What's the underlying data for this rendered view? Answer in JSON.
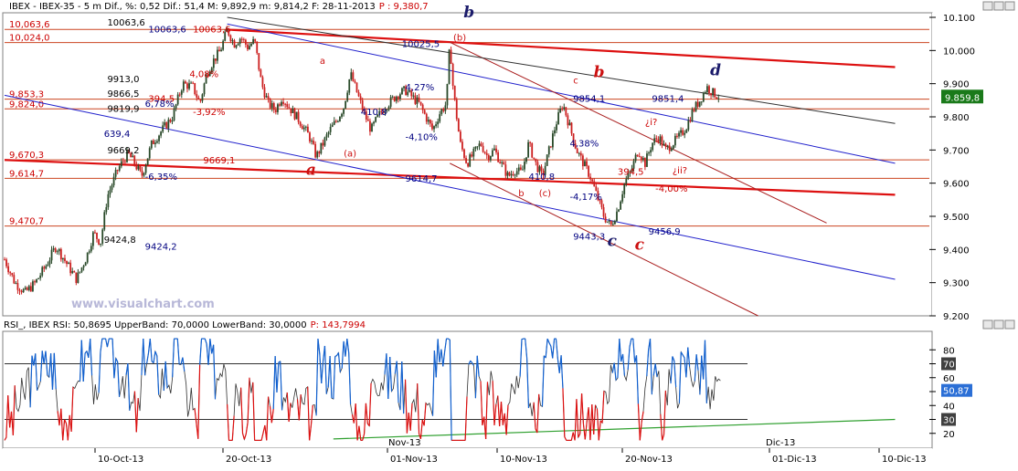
{
  "header": {
    "left": "IBEX - IBEX-35 -  5 m Dif.,  %: 0,52 Dif.: 51,4 M: 9,892,9 m: 9,814,2 F: 28-11-2013",
    "p_label": "P : ",
    "p_value": "9,380,7"
  },
  "rsi_header": {
    "left": "RSI_, IBEX RSI: 50,8695 UpperBand: 70,0000 LowerBand: 30,0000",
    "p_label": "P: ",
    "p_value": "143,7994"
  },
  "colors": {
    "candle_up": "#2a4a2a",
    "candle_down": "#cc2020",
    "level_line": "#cc4420",
    "channel_blue": "#2020cc",
    "channel_red": "#dd1010",
    "channel_darkred": "#aa2020",
    "price_box": "#1a7a1a",
    "rsi_line": "#303030",
    "rsi_up": "#1060d0",
    "rsi_down": "#dd1010",
    "rsi_trend": "#30a030",
    "rsi_box": "#2b6fd6"
  },
  "watermark": "www.visualchart.com",
  "chart_data": [
    {
      "type": "candlestick",
      "title": "IBEX - IBEX-35 - 5 m",
      "x_ticks": [
        "10-Oct-13",
        "20-Oct-13",
        "01-Nov-13",
        "10-Nov-13",
        "20-Nov-13",
        "01-Dic-13",
        "10-Dic-13"
      ],
      "month_marks": [
        "Nov-13",
        "Dic-13"
      ],
      "y_ticks": [
        "10.100",
        "10.000",
        "9.900",
        "9.800",
        "9.700",
        "9.600",
        "9.500",
        "9.400",
        "9.300",
        "9.200"
      ],
      "y_tick_values": [
        10100,
        10000,
        9900,
        9800,
        9700,
        9600,
        9500,
        9400,
        9300,
        9200
      ],
      "ylim": [
        9200,
        10100
      ],
      "last_price_label": "9.859,8",
      "last_price": 9859.8,
      "levels": [
        {
          "label": "10,063,6",
          "value": 10063.6
        },
        {
          "label": "10,024,0",
          "value": 10024.0
        },
        {
          "label": "9,853,3",
          "value": 9853.3
        },
        {
          "label": "9,824,0",
          "value": 9824.0
        },
        {
          "label": "9,670,3",
          "value": 9670.3
        },
        {
          "label": "9,614,7",
          "value": 9614.7
        },
        {
          "label": "9,470,7",
          "value": 9470.7
        }
      ],
      "path": [
        [
          0,
          9370
        ],
        [
          3,
          9300
        ],
        [
          6,
          9270
        ],
        [
          9,
          9300
        ],
        [
          12,
          9350
        ],
        [
          15,
          9410
        ],
        [
          18,
          9360
        ],
        [
          21,
          9310
        ],
        [
          24,
          9380
        ],
        [
          26,
          9450
        ],
        [
          28,
          9420
        ],
        [
          30,
          9560
        ],
        [
          33,
          9640
        ],
        [
          36,
          9690
        ],
        [
          38,
          9660
        ],
        [
          40,
          9620
        ],
        [
          43,
          9720
        ],
        [
          46,
          9760
        ],
        [
          49,
          9800
        ],
        [
          52,
          9900
        ],
        [
          55,
          9890
        ],
        [
          57,
          9840
        ],
        [
          59,
          9930
        ],
        [
          61,
          9970
        ],
        [
          63,
          10000
        ],
        [
          65,
          10063
        ],
        [
          67,
          10020
        ],
        [
          69,
          10040
        ],
        [
          71,
          10010
        ],
        [
          73,
          10030
        ],
        [
          75,
          9900
        ],
        [
          77,
          9840
        ],
        [
          79,
          9820
        ],
        [
          81,
          9860
        ],
        [
          83,
          9830
        ],
        [
          86,
          9790
        ],
        [
          89,
          9740
        ],
        [
          91,
          9680
        ],
        [
          93,
          9720
        ],
        [
          95,
          9760
        ],
        [
          97,
          9790
        ],
        [
          99,
          9830
        ],
        [
          101,
          9930
        ],
        [
          103,
          9870
        ],
        [
          105,
          9810
        ],
        [
          107,
          9760
        ],
        [
          109,
          9800
        ],
        [
          111,
          9830
        ],
        [
          113,
          9850
        ],
        [
          115,
          9870
        ],
        [
          117,
          9880
        ],
        [
          119,
          9860
        ],
        [
          121,
          9840
        ],
        [
          123,
          9800
        ],
        [
          125,
          9760
        ],
        [
          127,
          9810
        ],
        [
          129,
          9840
        ],
        [
          130,
          10025
        ],
        [
          131,
          9880
        ],
        [
          133,
          9720
        ],
        [
          135,
          9660
        ],
        [
          137,
          9690
        ],
        [
          139,
          9720
        ],
        [
          141,
          9680
        ],
        [
          143,
          9700
        ],
        [
          145,
          9660
        ],
        [
          147,
          9620
        ],
        [
          149,
          9640
        ],
        [
          151,
          9630
        ],
        [
          153,
          9720
        ],
        [
          155,
          9660
        ],
        [
          157,
          9620
        ],
        [
          159,
          9700
        ],
        [
          161,
          9780
        ],
        [
          163,
          9840
        ],
        [
          165,
          9770
        ],
        [
          167,
          9700
        ],
        [
          169,
          9660
        ],
        [
          171,
          9620
        ],
        [
          173,
          9560
        ],
        [
          175,
          9500
        ],
        [
          177,
          9470
        ],
        [
          179,
          9520
        ],
        [
          181,
          9600
        ],
        [
          183,
          9640
        ],
        [
          185,
          9700
        ],
        [
          187,
          9660
        ],
        [
          189,
          9720
        ],
        [
          191,
          9740
        ],
        [
          193,
          9700
        ],
        [
          195,
          9720
        ],
        [
          197,
          9740
        ],
        [
          199,
          9770
        ],
        [
          201,
          9820
        ],
        [
          203,
          9850
        ],
        [
          205,
          9890
        ],
        [
          207,
          9870
        ],
        [
          209,
          9860
        ]
      ],
      "trendlines": [
        {
          "kind": "red",
          "from": [
            0,
            9670
          ],
          "to": [
            260,
            9565
          ]
        },
        {
          "kind": "red",
          "from": [
            65,
            10063
          ],
          "to": [
            260,
            9950
          ]
        },
        {
          "kind": "blue",
          "from": [
            0,
            9865
          ],
          "to": [
            260,
            9310
          ]
        },
        {
          "kind": "blue",
          "from": [
            65,
            10080
          ],
          "to": [
            260,
            9660
          ]
        },
        {
          "kind": "darkred",
          "from": [
            130,
            10025
          ],
          "to": [
            240,
            9480
          ]
        },
        {
          "kind": "darkred",
          "from": [
            130,
            9660
          ],
          "to": [
            220,
            9200
          ]
        },
        {
          "kind": "black",
          "from": [
            65,
            10100
          ],
          "to": [
            260,
            9780
          ]
        }
      ],
      "wave_labels": [
        {
          "text": "b",
          "style": "big",
          "color": "#1a1a6a",
          "x": 134,
          "y": 10100
        },
        {
          "text": "a",
          "style": "big",
          "color": "#cc1010",
          "x": 88,
          "y": 9625
        },
        {
          "text": "b",
          "style": "big",
          "color": "#cc1010",
          "x": 172,
          "y": 9920
        },
        {
          "text": "d",
          "style": "big",
          "color": "#1a1a6a",
          "x": 206,
          "y": 9925
        },
        {
          "text": "c",
          "style": "big",
          "color": "#1a1a6a",
          "x": 176,
          "y": 9410
        },
        {
          "text": "c",
          "style": "big",
          "color": "#cc1010",
          "x": 184,
          "y": 9400
        },
        {
          "text": "a",
          "style": "small",
          "color": "#cc1010",
          "x": 92,
          "y": 9960
        },
        {
          "text": "(a)",
          "style": "small",
          "color": "#cc1010",
          "x": 99,
          "y": 9680
        },
        {
          "text": "(b)",
          "style": "small",
          "color": "#cc1010",
          "x": 131,
          "y": 10030
        },
        {
          "text": "c",
          "style": "small",
          "color": "#cc1010",
          "x": 166,
          "y": 9900
        },
        {
          "text": "b",
          "style": "small",
          "color": "#cc1010",
          "x": 150,
          "y": 9560
        },
        {
          "text": "(c)",
          "style": "small",
          "color": "#cc1010",
          "x": 156,
          "y": 9560
        }
      ],
      "annotations": [
        {
          "text": "10063,6",
          "color": "black",
          "x": 30,
          "y": 10075
        },
        {
          "text": "10063,6",
          "color": "blue",
          "x": 42,
          "y": 10055
        },
        {
          "text": "10063,6",
          "color": "red",
          "x": 55,
          "y": 10055
        },
        {
          "text": "10025,5",
          "color": "blue",
          "x": 116,
          "y": 10010
        },
        {
          "text": "9913,0",
          "color": "black",
          "x": 30,
          "y": 9905
        },
        {
          "text": "9866,5",
          "color": "black",
          "x": 30,
          "y": 9860
        },
        {
          "text": "394,5",
          "color": "red",
          "x": 42,
          "y": 9845
        },
        {
          "text": "6,78%",
          "color": "blue",
          "x": 41,
          "y": 9830
        },
        {
          "text": "9819,9",
          "color": "black",
          "x": 30,
          "y": 9815
        },
        {
          "text": "4,08%",
          "color": "red",
          "x": 54,
          "y": 9920
        },
        {
          "text": "-3,92%",
          "color": "red",
          "x": 55,
          "y": 9805
        },
        {
          "text": "639,4",
          "color": "blue",
          "x": 29,
          "y": 9740
        },
        {
          "text": "9669,2",
          "color": "black",
          "x": 30,
          "y": 9690
        },
        {
          "text": "9669,1",
          "color": "red",
          "x": 58,
          "y": 9660
        },
        {
          "text": "-6,35%",
          "color": "blue",
          "x": 41,
          "y": 9610
        },
        {
          "text": "410,8",
          "color": "blue",
          "x": 104,
          "y": 9805
        },
        {
          "text": "4,27%",
          "color": "blue",
          "x": 117,
          "y": 9880
        },
        {
          "text": "-4,10%",
          "color": "blue",
          "x": 117,
          "y": 9730
        },
        {
          "text": "9614,7",
          "color": "blue",
          "x": 117,
          "y": 9605
        },
        {
          "text": "9854,1",
          "color": "blue",
          "x": 166,
          "y": 9845
        },
        {
          "text": "4,38%",
          "color": "blue",
          "x": 165,
          "y": 9710
        },
        {
          "text": "-4,17%",
          "color": "blue",
          "x": 165,
          "y": 9550
        },
        {
          "text": "410,8",
          "color": "blue",
          "x": 153,
          "y": 9610
        },
        {
          "text": "9443,3",
          "color": "blue",
          "x": 166,
          "y": 9430
        },
        {
          "text": "9851,4",
          "color": "blue",
          "x": 189,
          "y": 9845
        },
        {
          "text": "394,5",
          "color": "red",
          "x": 179,
          "y": 9625
        },
        {
          "text": "-4,00%",
          "color": "red",
          "x": 190,
          "y": 9575
        },
        {
          "text": "9456,9",
          "color": "blue",
          "x": 188,
          "y": 9445
        },
        {
          "text": "¿i?",
          "color": "red",
          "x": 187,
          "y": 9775
        },
        {
          "text": "¿ii?",
          "color": "red",
          "x": 195,
          "y": 9630
        },
        {
          "text": "9424,8",
          "color": "black",
          "x": 29,
          "y": 9420
        },
        {
          "text": "9424,2",
          "color": "blue",
          "x": 41,
          "y": 9400
        }
      ]
    },
    {
      "type": "line",
      "title": "RSI_, IBEX RSI",
      "ylim": [
        10,
        90
      ],
      "y_ticks": [
        "80",
        "70",
        "60",
        "50",
        "40",
        "30",
        "20"
      ],
      "y_tick_values": [
        80,
        70,
        60,
        50,
        40,
        30,
        20
      ],
      "upper_band": 70,
      "lower_band": 30,
      "upper_band_label": "70",
      "lower_band_label": "30",
      "last_value": 50.8695,
      "last_value_label": "50,87",
      "trendline": {
        "from": [
          96,
          16
        ],
        "to": [
          260,
          30
        ]
      }
    }
  ]
}
